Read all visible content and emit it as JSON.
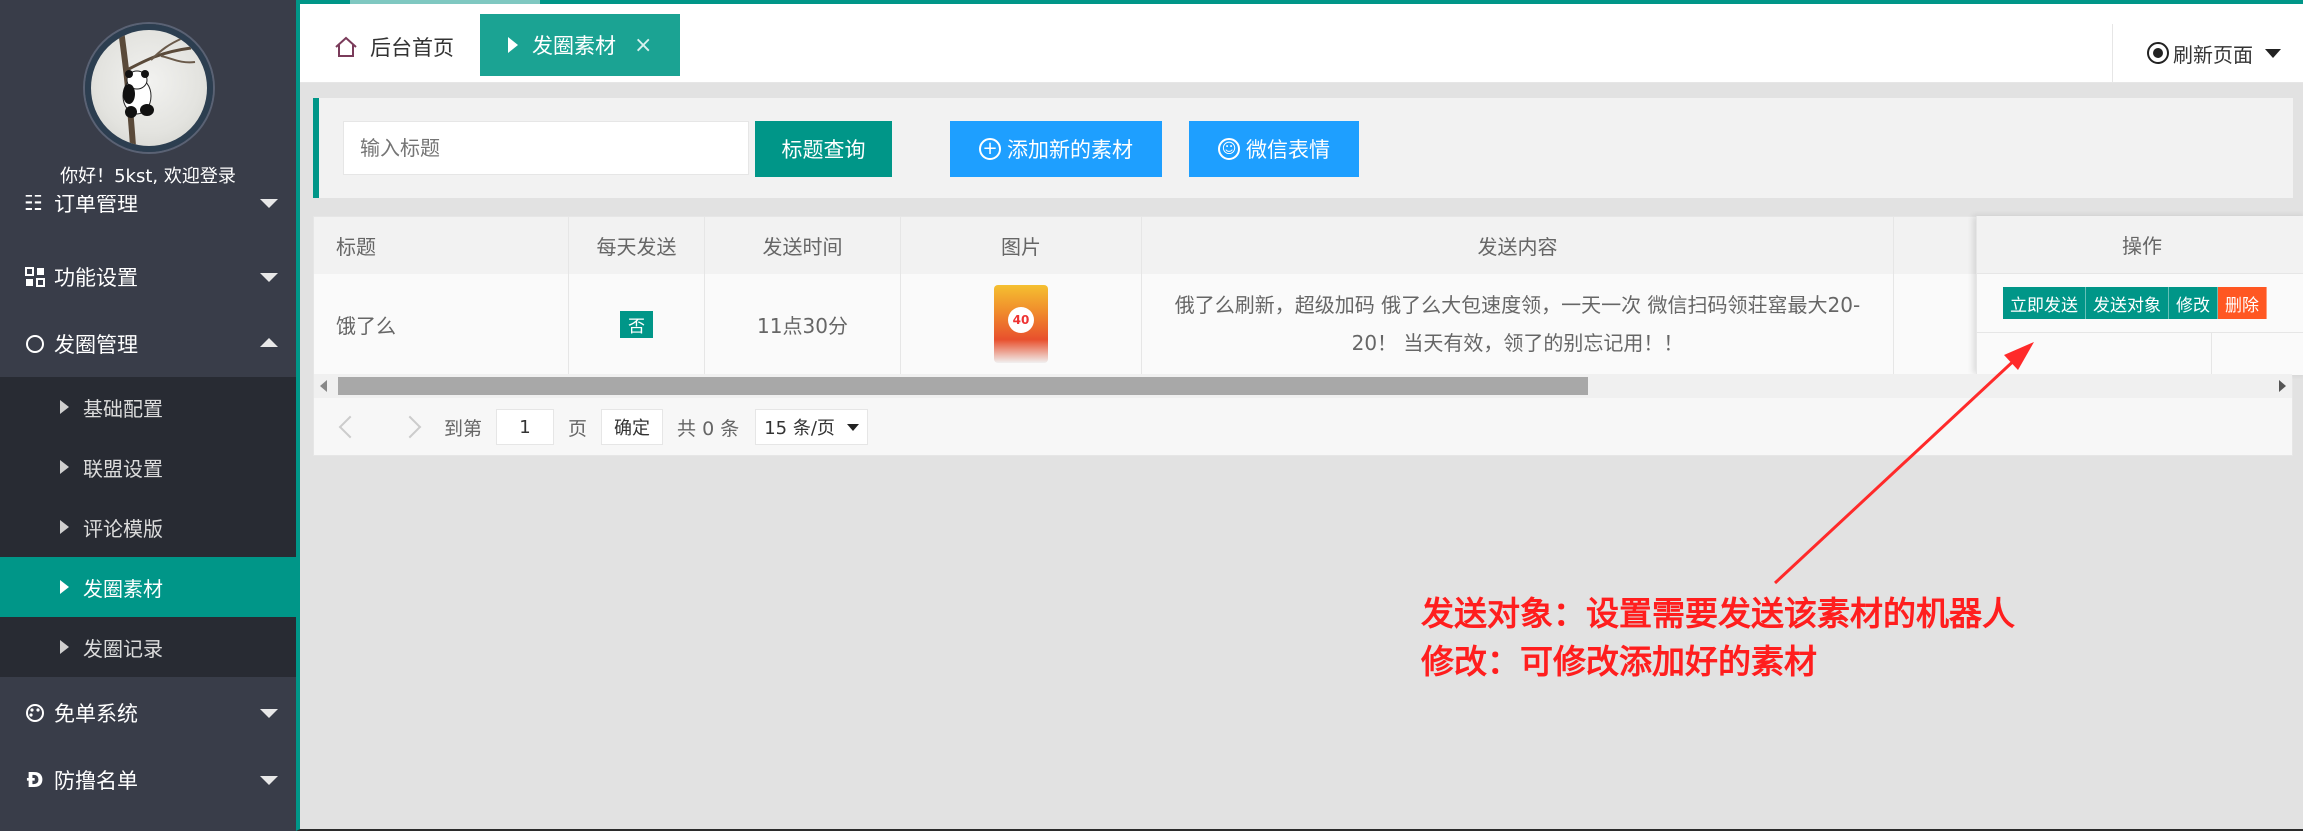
{
  "sidebar": {
    "welcome": "你好！5kst, 欢迎登录",
    "partial_item": "订单管理",
    "menus": [
      {
        "label": "功能设置"
      },
      {
        "label": "发圈管理"
      },
      {
        "label": "免单系统"
      },
      {
        "label": "防撸名单"
      }
    ],
    "submenu": [
      {
        "label": "基础配置"
      },
      {
        "label": "联盟设置"
      },
      {
        "label": "评论模版"
      },
      {
        "label": "发圈素材"
      },
      {
        "label": "发圈记录"
      }
    ]
  },
  "tabs": {
    "home": "后台首页",
    "active": "发圈素材",
    "close": "×",
    "refresh": "刷新页面"
  },
  "search": {
    "placeholder": "输入标题",
    "query_btn": "标题查询",
    "add_btn": "添加新的素材",
    "emoji_btn": "微信表情"
  },
  "table": {
    "headers": [
      "标题",
      "每天发送",
      "发送时间",
      "图片",
      "发送内容",
      "操作"
    ],
    "rows": [
      {
        "title": "饿了么",
        "daily": "否",
        "time": "11点30分",
        "thumb_text": "40",
        "content": "俄了么刷新，超级加码 俄了么大包速度领，一天一次 微信扫码领荘窰最大20-20！ 当天有效，领了的别忘记用！！"
      }
    ],
    "actions": [
      "立即发送",
      "发送对象",
      "修改",
      "删除"
    ]
  },
  "pager": {
    "goto": "到第",
    "page_value": "1",
    "page_unit": "页",
    "confirm": "确定",
    "total": "共 0 条",
    "per_page": "15 条/页"
  },
  "annotation": {
    "line1": "发送对象：设置需要发送该素材的机器人",
    "line2": "修改：可修改添加好的素材"
  },
  "colors": {
    "sidebar_bg": "#393d49",
    "submenu_bg": "#282b33",
    "accent": "#009688",
    "blue": "#1e9fff",
    "danger": "#ff5722",
    "annotation": "#ff1e1e"
  }
}
